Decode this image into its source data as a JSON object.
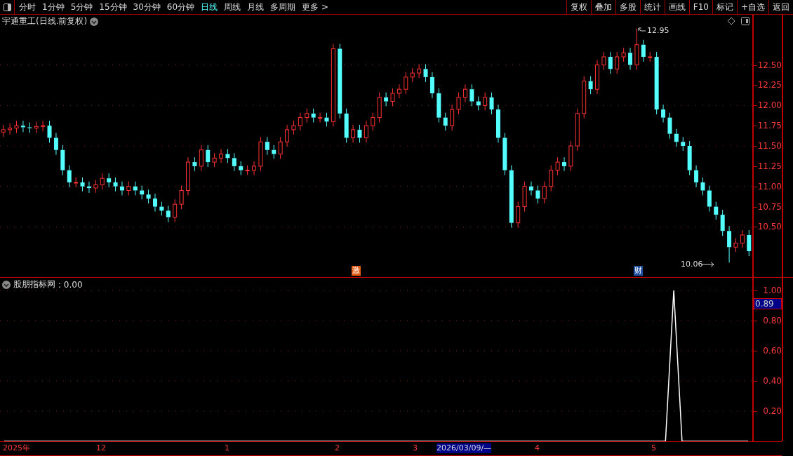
{
  "toolbar": {
    "periods": [
      {
        "label": "分时",
        "selected": false
      },
      {
        "label": "1分钟",
        "selected": false
      },
      {
        "label": "5分钟",
        "selected": false
      },
      {
        "label": "15分钟",
        "selected": false
      },
      {
        "label": "30分钟",
        "selected": false
      },
      {
        "label": "60分钟",
        "selected": false
      },
      {
        "label": "日线",
        "selected": true
      },
      {
        "label": "周线",
        "selected": false
      },
      {
        "label": "月线",
        "selected": false
      },
      {
        "label": "多周期",
        "selected": false
      },
      {
        "label": "更多 >",
        "selected": false
      }
    ],
    "buttons": [
      "复权",
      "叠加",
      "多股",
      "统计",
      "画线",
      "F10",
      "标记",
      "+自选",
      "返回"
    ]
  },
  "price_chart": {
    "title": "宇通重工(日线.前复权)",
    "high_label": "12.95",
    "low_label": "10.06",
    "markers": [
      {
        "label": "激",
        "color": "#e05a10"
      },
      {
        "label": "财",
        "color": "#2050a0"
      }
    ],
    "chart_data": {
      "type": "candlestick",
      "ylim": [
        9.88,
        13.12
      ],
      "grid": true,
      "yticks": [
        {
          "value": 12.5,
          "label": "12.50"
        },
        {
          "value": 12.25,
          "label": "12.25"
        },
        {
          "value": 12.0,
          "label": "12.00"
        },
        {
          "value": 11.75,
          "label": "11.75"
        },
        {
          "value": 11.5,
          "label": "11.50"
        },
        {
          "value": 11.25,
          "label": "11.25"
        },
        {
          "value": 11.0,
          "label": "11.00"
        },
        {
          "value": 10.75,
          "label": "10.75"
        },
        {
          "value": 10.5,
          "label": "10.50"
        }
      ],
      "ohlc": [
        [
          11.67,
          11.76,
          11.61,
          11.7
        ],
        [
          11.7,
          11.78,
          11.64,
          11.72
        ],
        [
          11.72,
          11.81,
          11.66,
          11.75
        ],
        [
          11.75,
          11.81,
          11.67,
          11.73
        ],
        [
          11.73,
          11.79,
          11.66,
          11.72
        ],
        [
          11.72,
          11.8,
          11.66,
          11.74
        ],
        [
          11.74,
          11.81,
          11.68,
          11.75
        ],
        [
          11.75,
          11.81,
          11.54,
          11.6
        ],
        [
          11.6,
          11.66,
          11.39,
          11.45
        ],
        [
          11.45,
          11.51,
          11.14,
          11.2
        ],
        [
          11.2,
          11.26,
          10.99,
          11.05
        ],
        [
          11.05,
          11.11,
          10.99,
          11.05
        ],
        [
          11.05,
          11.11,
          10.94,
          11.0
        ],
        [
          11.0,
          11.06,
          10.92,
          10.98
        ],
        [
          10.98,
          11.08,
          10.92,
          11.02
        ],
        [
          11.02,
          11.16,
          10.96,
          11.1
        ],
        [
          11.1,
          11.16,
          10.99,
          11.05
        ],
        [
          11.05,
          11.11,
          10.94,
          11.0
        ],
        [
          11.0,
          11.06,
          10.89,
          10.95
        ],
        [
          10.95,
          11.06,
          10.89,
          11.0
        ],
        [
          11.0,
          11.06,
          10.89,
          10.95
        ],
        [
          10.95,
          11.01,
          10.84,
          10.9
        ],
        [
          10.9,
          10.96,
          10.79,
          10.85
        ],
        [
          10.85,
          10.91,
          10.69,
          10.75
        ],
        [
          10.75,
          10.81,
          10.64,
          10.7
        ],
        [
          10.7,
          10.76,
          10.56,
          10.62
        ],
        [
          10.62,
          10.84,
          10.56,
          10.78
        ],
        [
          10.78,
          11.01,
          10.72,
          10.95
        ],
        [
          10.95,
          11.36,
          10.89,
          11.3
        ],
        [
          11.3,
          11.36,
          11.19,
          11.25
        ],
        [
          11.25,
          11.51,
          11.19,
          11.45
        ],
        [
          11.45,
          11.51,
          11.24,
          11.3
        ],
        [
          11.3,
          11.41,
          11.24,
          11.35
        ],
        [
          11.35,
          11.46,
          11.29,
          11.4
        ],
        [
          11.4,
          11.46,
          11.29,
          11.35
        ],
        [
          11.35,
          11.41,
          11.19,
          11.25
        ],
        [
          11.25,
          11.31,
          11.14,
          11.2
        ],
        [
          11.2,
          11.26,
          11.14,
          11.2
        ],
        [
          11.2,
          11.31,
          11.14,
          11.25
        ],
        [
          11.25,
          11.61,
          11.19,
          11.55
        ],
        [
          11.55,
          11.61,
          11.39,
          11.45
        ],
        [
          11.45,
          11.51,
          11.34,
          11.4
        ],
        [
          11.4,
          11.61,
          11.34,
          11.55
        ],
        [
          11.55,
          11.76,
          11.49,
          11.7
        ],
        [
          11.7,
          11.81,
          11.64,
          11.75
        ],
        [
          11.75,
          11.91,
          11.69,
          11.85
        ],
        [
          11.85,
          11.96,
          11.79,
          11.9
        ],
        [
          11.9,
          11.96,
          11.79,
          11.85
        ],
        [
          11.85,
          11.91,
          11.79,
          11.85
        ],
        [
          11.85,
          11.91,
          11.74,
          11.8
        ],
        [
          11.8,
          12.76,
          11.74,
          12.7
        ],
        [
          12.7,
          12.76,
          11.84,
          11.9
        ],
        [
          11.9,
          11.96,
          11.54,
          11.6
        ],
        [
          11.6,
          11.76,
          11.54,
          11.7
        ],
        [
          11.7,
          11.76,
          11.54,
          11.6
        ],
        [
          11.6,
          11.81,
          11.54,
          11.75
        ],
        [
          11.75,
          11.91,
          11.69,
          11.85
        ],
        [
          11.85,
          12.16,
          11.79,
          12.1
        ],
        [
          12.1,
          12.16,
          11.99,
          12.05
        ],
        [
          12.05,
          12.21,
          11.99,
          12.15
        ],
        [
          12.15,
          12.26,
          12.09,
          12.2
        ],
        [
          12.2,
          12.41,
          12.14,
          12.35
        ],
        [
          12.35,
          12.46,
          12.29,
          12.4
        ],
        [
          12.4,
          12.51,
          12.34,
          12.45
        ],
        [
          12.45,
          12.51,
          12.29,
          12.35
        ],
        [
          12.35,
          12.41,
          12.09,
          12.15
        ],
        [
          12.15,
          12.21,
          11.79,
          11.85
        ],
        [
          11.85,
          11.91,
          11.69,
          11.75
        ],
        [
          11.75,
          12.01,
          11.69,
          11.95
        ],
        [
          11.95,
          12.16,
          11.89,
          12.1
        ],
        [
          12.1,
          12.26,
          12.04,
          12.2
        ],
        [
          12.2,
          12.26,
          11.99,
          12.05
        ],
        [
          12.05,
          12.11,
          11.94,
          12.0
        ],
        [
          12.0,
          12.16,
          11.94,
          12.1
        ],
        [
          12.1,
          12.16,
          11.89,
          11.95
        ],
        [
          11.95,
          12.01,
          11.54,
          11.6
        ],
        [
          11.6,
          11.66,
          11.14,
          11.2
        ],
        [
          11.2,
          11.26,
          10.49,
          10.55
        ],
        [
          10.55,
          10.81,
          10.49,
          10.75
        ],
        [
          10.75,
          11.06,
          10.69,
          11.0
        ],
        [
          11.0,
          11.06,
          10.89,
          10.95
        ],
        [
          10.95,
          11.01,
          10.79,
          10.85
        ],
        [
          10.85,
          11.06,
          10.79,
          11.0
        ],
        [
          11.0,
          11.26,
          10.94,
          11.2
        ],
        [
          11.2,
          11.36,
          11.14,
          11.3
        ],
        [
          11.3,
          11.36,
          11.19,
          11.25
        ],
        [
          11.25,
          11.56,
          11.19,
          11.5
        ],
        [
          11.5,
          11.96,
          11.44,
          11.9
        ],
        [
          11.9,
          12.36,
          11.84,
          12.3
        ],
        [
          12.3,
          12.36,
          12.14,
          12.2
        ],
        [
          12.2,
          12.56,
          12.14,
          12.5
        ],
        [
          12.5,
          12.66,
          12.44,
          12.6
        ],
        [
          12.6,
          12.66,
          12.39,
          12.45
        ],
        [
          12.45,
          12.66,
          12.39,
          12.6
        ],
        [
          12.6,
          12.71,
          12.54,
          12.65
        ],
        [
          12.65,
          12.71,
          12.44,
          12.5
        ],
        [
          12.5,
          12.95,
          12.44,
          12.75
        ],
        [
          12.75,
          12.81,
          12.54,
          12.6
        ],
        [
          12.6,
          12.66,
          12.54,
          12.6
        ],
        [
          12.6,
          12.66,
          11.89,
          11.95
        ],
        [
          11.95,
          12.01,
          11.79,
          11.85
        ],
        [
          11.85,
          11.91,
          11.59,
          11.65
        ],
        [
          11.65,
          11.71,
          11.49,
          11.55
        ],
        [
          11.55,
          11.61,
          11.44,
          11.5
        ],
        [
          11.5,
          11.56,
          11.14,
          11.2
        ],
        [
          11.2,
          11.26,
          10.99,
          11.05
        ],
        [
          11.05,
          11.11,
          10.89,
          10.95
        ],
        [
          10.95,
          11.01,
          10.69,
          10.75
        ],
        [
          10.75,
          10.81,
          10.59,
          10.65
        ],
        [
          10.65,
          10.71,
          10.39,
          10.45
        ],
        [
          10.45,
          10.51,
          10.06,
          10.25
        ],
        [
          10.25,
          10.36,
          10.19,
          10.3
        ],
        [
          10.3,
          10.46,
          10.24,
          10.4
        ],
        [
          10.4,
          10.46,
          10.14,
          10.2
        ]
      ]
    }
  },
  "indicator": {
    "current_value": ": 0.00",
    "cursor_value": "0.89",
    "chart_data": {
      "type": "line",
      "ylim": [
        0,
        1.0
      ],
      "grid": true,
      "yticks": [
        {
          "value": 0.2,
          "label": "0.20"
        },
        {
          "value": 0.4,
          "label": "0.40"
        },
        {
          "value": 0.6,
          "label": "0.60"
        },
        {
          "value": 0.8,
          "label": "0.80"
        },
        {
          "value": 1.0,
          "label": "1.00"
        }
      ],
      "series": [
        {
          "name": "股朋指标网",
          "color": "#ffffff",
          "values": [
            0,
            0,
            0,
            0,
            0,
            0,
            0,
            0,
            0,
            0,
            0,
            0,
            0,
            0,
            0,
            0,
            0,
            0,
            0,
            0,
            0,
            0,
            0,
            0,
            0,
            0,
            0,
            0,
            0,
            0,
            0,
            0,
            0,
            0,
            0,
            0,
            0,
            0,
            0,
            0,
            0,
            0,
            0,
            0,
            0,
            0,
            0,
            0,
            0,
            0,
            0,
            0,
            0,
            0,
            0,
            0,
            0,
            0,
            0,
            0,
            0,
            0,
            0,
            0,
            0,
            0,
            0,
            0,
            0,
            0,
            0,
            0,
            0,
            0,
            0,
            0,
            0,
            0,
            0,
            0,
            0,
            1,
            0,
            0,
            0,
            0,
            0,
            0,
            0,
            0,
            0
          ]
        }
      ]
    }
  },
  "date_axis": [
    {
      "label": "2025年",
      "selected": false
    },
    {
      "label": "12",
      "selected": false
    },
    {
      "label": "1",
      "selected": false
    },
    {
      "label": "2",
      "selected": false
    },
    {
      "label": "3",
      "selected": false
    },
    {
      "label": "2026/03/09/—",
      "selected": true
    },
    {
      "label": "4",
      "selected": false
    },
    {
      "label": "5",
      "selected": false
    }
  ]
}
